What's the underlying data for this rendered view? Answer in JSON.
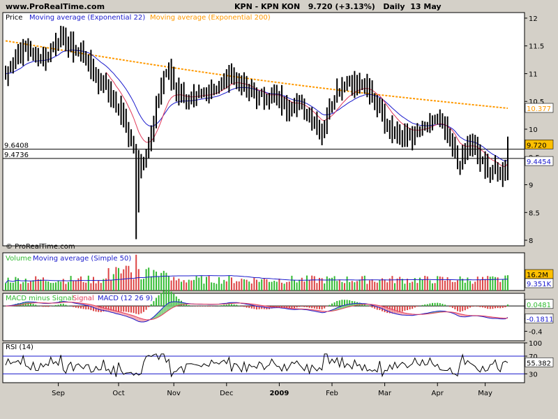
{
  "header": {
    "site": "www.ProRealTime.com",
    "instrument": "KPN - KPN KON",
    "last": "9.720",
    "change": "(+3.13%)",
    "period": "Daily",
    "date": "13 May"
  },
  "colors": {
    "price_bar": "#000000",
    "ema22": "#1a1acc",
    "ema200": "#ff9900",
    "wma": "#e23a5a",
    "vol_up": "#33bb33",
    "vol_down": "#dd4444",
    "vol_ma": "#1a1acc",
    "macd_line": "#1a1acc",
    "signal_line": "#e23a5a",
    "macd_hist_up": "#33bb33",
    "macd_hist_down": "#dd4444",
    "macd_fill_pos": "#77cc77",
    "macd_fill_neg": "#f3a0a8",
    "rsi_line": "#000000",
    "rsi_band": "#1a1acc",
    "last_badge": "#ffc000"
  },
  "chart_data": [
    {
      "type": "ohlc",
      "panel": "price",
      "title": "Price",
      "legend": [
        {
          "name": "Moving average (Exponential 22)",
          "color": "#1a1acc"
        },
        {
          "name": "Moving average (Exponential 200)",
          "color": "#ff9900"
        }
      ],
      "copyright": "© ProRealTime.com",
      "ylim": [
        7.9,
        12.1
      ],
      "y_ticks": [
        "8",
        "8.5",
        "9",
        "9.5",
        "10",
        "10.5",
        "11",
        "11.5",
        "12"
      ],
      "x_ticks": [
        "Sep",
        "Oct",
        "Nov",
        "Dec",
        "2009",
        "Feb",
        "Mar",
        "Apr",
        "May"
      ],
      "h_lines": [
        {
          "label": "9.6408",
          "value": 9.6408
        },
        {
          "label": "9.4736",
          "value": 9.4736
        }
      ],
      "right_labels": [
        {
          "text": "10.377",
          "value": 10.377,
          "style": "ema200"
        },
        {
          "text": "9.720",
          "value": 9.72,
          "style": "last"
        },
        {
          "text": "9.4454",
          "value": 9.4454,
          "style": "ema22"
        }
      ],
      "close_anchors": [
        [
          0,
          11.0
        ],
        [
          5,
          11.35
        ],
        [
          8,
          11.5
        ],
        [
          12,
          11.3
        ],
        [
          16,
          11.3
        ],
        [
          20,
          11.6
        ],
        [
          22,
          11.7
        ],
        [
          24,
          11.55
        ],
        [
          28,
          11.4
        ],
        [
          32,
          11.3
        ],
        [
          36,
          10.9
        ],
        [
          40,
          10.8
        ],
        [
          44,
          10.4
        ],
        [
          47,
          10.2
        ],
        [
          49,
          9.9
        ],
        [
          51,
          9.6
        ],
        [
          53,
          9.3
        ],
        [
          55,
          9.5
        ],
        [
          58,
          9.9
        ],
        [
          61,
          10.6
        ],
        [
          63,
          11.0
        ],
        [
          65,
          11.05
        ],
        [
          67,
          10.8
        ],
        [
          70,
          10.6
        ],
        [
          74,
          10.5
        ],
        [
          78,
          10.6
        ],
        [
          82,
          10.7
        ],
        [
          86,
          10.8
        ],
        [
          90,
          11.0
        ],
        [
          93,
          10.85
        ],
        [
          96,
          10.7
        ],
        [
          100,
          10.6
        ],
        [
          104,
          10.55
        ],
        [
          108,
          10.6
        ],
        [
          112,
          10.4
        ],
        [
          116,
          10.45
        ],
        [
          120,
          10.3
        ],
        [
          123,
          10.1
        ],
        [
          126,
          9.95
        ],
        [
          128,
          10.3
        ],
        [
          131,
          10.6
        ],
        [
          134,
          10.8
        ],
        [
          138,
          10.85
        ],
        [
          142,
          10.8
        ],
        [
          146,
          10.6
        ],
        [
          149,
          10.4
        ],
        [
          152,
          10.1
        ],
        [
          156,
          9.9
        ],
        [
          160,
          9.85
        ],
        [
          164,
          9.95
        ],
        [
          168,
          10.05
        ],
        [
          172,
          10.2
        ],
        [
          175,
          9.95
        ],
        [
          178,
          9.7
        ],
        [
          180,
          9.35
        ],
        [
          183,
          9.55
        ],
        [
          185,
          9.75
        ],
        [
          188,
          9.55
        ],
        [
          191,
          9.3
        ],
        [
          195,
          9.25
        ],
        [
          198,
          9.18
        ],
        [
          199,
          9.3
        ],
        [
          200,
          9.72
        ]
      ],
      "close": 9.72,
      "ema22_last": 9.4454,
      "ema200_last": 10.377
    },
    {
      "type": "bar",
      "panel": "volume",
      "title": "Volume",
      "legend": [
        {
          "name": "Moving average (Simple 50)",
          "color": "#1a1acc"
        }
      ],
      "right_labels": [
        {
          "text": "16.2M",
          "style": "last"
        },
        {
          "text": "9.351K",
          "style": "ma"
        }
      ],
      "last_volume_m": 16.2,
      "ma50_label": "9.351K"
    },
    {
      "type": "line",
      "panel": "macd",
      "title": "MACD minus Signal",
      "legend": [
        {
          "name": "Signal",
          "color": "#e23a5a"
        },
        {
          "name": "MACD (12 26 9)",
          "color": "#1a1acc"
        }
      ],
      "ylim": [
        -0.55,
        0.2
      ],
      "y_ticks": [
        "-0.2",
        "-0.4"
      ],
      "right_labels": [
        {
          "text": "0.0481",
          "value": 0.0481,
          "style": "hist"
        },
        {
          "text": "-0.1811",
          "value": -0.1811,
          "style": "macd"
        }
      ]
    },
    {
      "type": "line",
      "panel": "rsi",
      "title": "RSI (14)",
      "ylim": [
        10,
        100
      ],
      "y_ticks": [
        "100",
        "70",
        "30"
      ],
      "levels": [
        70,
        30
      ],
      "right_labels": [
        {
          "text": "55.382",
          "value": 55.382,
          "style": "rsi"
        }
      ],
      "last": 55.382
    }
  ]
}
